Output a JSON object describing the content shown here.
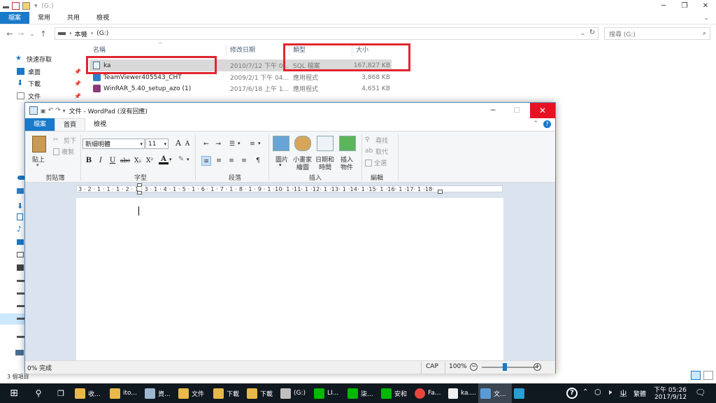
{
  "explorer": {
    "window_title": "(G:)",
    "tabs": [
      "檔案",
      "常用",
      "共用",
      "檢視"
    ],
    "address": {
      "pc": "本機",
      "drive": "(G:)"
    },
    "search_placeholder": "搜尋 (G:)",
    "sidebar": [
      {
        "label": "快速存取",
        "icon": "star-icon",
        "color": "#1979ca"
      },
      {
        "label": "桌面",
        "icon": "desktop-folder-icon",
        "color": "#1979ca"
      },
      {
        "label": "下載",
        "icon": "download-folder-icon",
        "color": "#1979ca"
      },
      {
        "label": "文件",
        "icon": "documents-folder-icon",
        "color": "#888888"
      }
    ],
    "columns": [
      "名稱",
      "修改日期",
      "類型",
      "大小"
    ],
    "files": [
      {
        "name": "ka",
        "date": "2010/7/12 下午 0...",
        "type": "SQL 檔案",
        "size": "167,827 KB",
        "icon": "sql-file-icon"
      },
      {
        "name": "TeamViewer405543_CHT",
        "date": "2009/2/1 下午 04...",
        "type": "應用程式",
        "size": "3,868 KB",
        "icon": "app-icon"
      },
      {
        "name": "WinRAR_5.40_setup_azo (1)",
        "date": "2017/6/18 上午 1...",
        "type": "應用程式",
        "size": "4,651 KB",
        "icon": "winrar-icon"
      }
    ],
    "status": "3 個項目"
  },
  "wordpad": {
    "title": "文件 - WordPad (沒有回應)",
    "tabs": [
      "檔案",
      "首頁",
      "檢視"
    ],
    "clipboard": {
      "paste": "貼上",
      "cut": "剪下",
      "copy": "複製",
      "label": "剪貼簿"
    },
    "font": {
      "name": "新細明體",
      "size": "11",
      "label": "字型"
    },
    "paragraph": {
      "label": "段落"
    },
    "insert": {
      "picture": "圖片",
      "paint_1": "小畫家",
      "paint_2": "繪圖",
      "datetime_1": "日期和",
      "datetime_2": "時間",
      "object_1": "插入",
      "object_2": "物件",
      "label": "插入"
    },
    "editing": {
      "find": "尋找",
      "replace": "取代",
      "select_all": "全選",
      "label": "編輯"
    },
    "ruler": "3 · 2 · 1 · 1 · 1 · 2 · 1 · 3 · 1 · 4 · 1 · 5 · 1 · 6 · 1 · 7 · 1 · 8 · 1 · 9 · 1 ·10· 1 ·11· 1 ·12· 1 ·13· 1 ·14· 1 ·15· 1 ·16· 1 ·17· 1 ·18·",
    "status_left": "0% 完成",
    "caps": "CAP",
    "zoom": "100%"
  },
  "taskbar": {
    "items": [
      "收...",
      "ito...",
      "資...",
      "文件",
      "下載",
      "下載",
      "(G:)",
      "LI...",
      "柒...",
      "安和",
      "Fa...",
      "ka....",
      "文..."
    ],
    "ime": "繁體",
    "time": "下午 05:26",
    "date": "2017/9/12"
  },
  "colors": {
    "accent": "#1979ca",
    "highlight": "#e0262e",
    "close": "#e81123"
  }
}
